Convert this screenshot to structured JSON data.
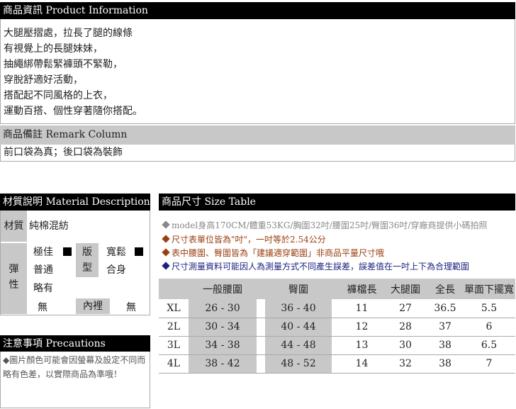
{
  "product_info": {
    "header": "商品資訊 Product Information",
    "lines": [
      "大腿壓摺處，拉長了腿的線條",
      "有視覺上的長腿妹妹，",
      "抽繩綁帶鬆緊褲頭不緊勒，",
      "穿脫舒適好活動，",
      "搭配起不同風格的上衣，",
      "運動百搭、個性穿著隨你搭配。"
    ]
  },
  "remark": {
    "header": "商品備註 Remark Column",
    "text": "前口袋為真；後口袋為裝飾"
  },
  "material": {
    "header": "材質說明 Material Description",
    "material_label": "材質",
    "material_value": "純棉混紡",
    "elastic_label": "彈性",
    "elastic_opts": [
      "極佳",
      "普通",
      "略有",
      "無"
    ],
    "fit_label": "版型",
    "fit_opts": [
      "寬鬆",
      "合身"
    ],
    "lining_label": "內裡",
    "lining_value": "無"
  },
  "precautions": {
    "header": "注意事項 Precautions",
    "text": "◆圖片顏色可能會因螢幕及設定不同而略有色差，以實際商品為準哦！"
  },
  "size_table": {
    "header": "商品尺寸 Size Table",
    "notes": [
      {
        "text": "model身高170CM/體重53KG/胸圍32吋/腰圍25吋/臀圍36吋/穿廠商提供小碼拍照",
        "color": "#888888"
      },
      {
        "text": "尺寸表單位皆為\"吋\"，一吋等於2.54公分",
        "color": "#9a3e10"
      },
      {
        "text": "表中腰圍、臀圍皆為「建議適穿範圍」非商品平量尺寸哦",
        "color": "#9a3e10"
      },
      {
        "text": "尺寸測量資料可能因人為測量方式不同產生誤差，誤差值在一吋上下為合理範圍",
        "color": "#1a237e"
      }
    ],
    "columns": [
      "",
      "一般腰圍",
      "臀圍",
      "褲檔長",
      "大腿圍",
      "全長",
      "單面下擺寬"
    ],
    "rows": [
      [
        "XL",
        "26 - 30",
        "36 - 40",
        "11",
        "27",
        "36.5",
        "5.5"
      ],
      [
        "2L",
        "30 - 34",
        "40 - 44",
        "12",
        "28",
        "37",
        "6"
      ],
      [
        "3L",
        "34 - 38",
        "44 - 48",
        "13",
        "30",
        "38",
        "6.5"
      ],
      [
        "4L",
        "38 - 42",
        "48 - 52",
        "14",
        "32",
        "38",
        "7"
      ]
    ]
  }
}
